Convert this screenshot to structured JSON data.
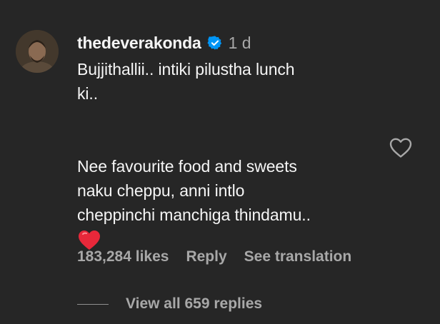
{
  "comment": {
    "username": "thedeverakonda",
    "verified": true,
    "time": "1 d",
    "line1": "Bujjithallii.. intiki pilustha lunch",
    "line2": "ki..",
    "line3": "Nee favourite food and sweets",
    "line4": "naku cheppu, anni intlo",
    "line5": "cheppinchi manchiga thindamu..",
    "emoji": "red-heart"
  },
  "actions": {
    "likes": "183,284 likes",
    "reply": "Reply",
    "translate": "See translation"
  },
  "replies": {
    "view_label": "View all 659 replies"
  },
  "icons": {
    "verified": "verified-badge-icon",
    "like": "heart-outline-icon",
    "emoji": "red-heart-emoji-icon"
  },
  "colors": {
    "background": "#262626",
    "primary_text": "#f5f5f5",
    "secondary_text": "#a8a8a8",
    "verified_blue": "#0095f6",
    "heart_red": "#ed4956"
  }
}
